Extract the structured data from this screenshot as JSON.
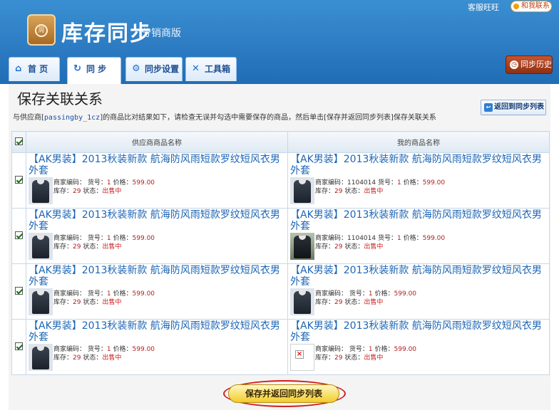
{
  "header": {
    "title": "库存同步",
    "subtitle": "分销商版",
    "logo_text": "周",
    "service_link": "客服旺旺",
    "contact_label": "和我联系"
  },
  "tabs": [
    {
      "label": "首 页",
      "icon": "home-icon"
    },
    {
      "label": "同 步",
      "icon": "sync-icon",
      "active": true
    },
    {
      "label": "同步设置",
      "icon": "settings-gear-icon"
    },
    {
      "label": "工具箱",
      "icon": "tools-icon"
    }
  ],
  "history_label": "同步历史",
  "page": {
    "title": "保存关联关系",
    "desc_before": "与供应商[",
    "supplier_account": "passingby_1cz",
    "desc_after": "]的商品比对结果如下，请检查无误并勾选中需要保存的商品，然后单击[保存并返回同步列表]保存关联关系",
    "back_label": "返回到同步列表"
  },
  "table": {
    "col_supplier": "供应商商品名称",
    "col_mine": "我的商品名称",
    "labels": {
      "code": "商家编码：",
      "sku": "货号：",
      "price": "价格：",
      "stock": "库存：",
      "status": "状态："
    },
    "rows": [
      {
        "checked": true,
        "supplier": {
          "name": "【AK男装】2013秋装新款 航海防风雨短款罗纹短风衣男外套",
          "code": "",
          "sku": "1",
          "price": "599.00",
          "stock": "29",
          "status": "出售中",
          "thumb": "jacket"
        },
        "mine": {
          "name": "【AK男装】2013秋装新款 航海防风雨短款罗纹短风衣男外套",
          "code": "1104014",
          "sku": "1",
          "price": "599.00",
          "stock": "29",
          "status": "出售中",
          "thumb": "jacket"
        }
      },
      {
        "checked": true,
        "supplier": {
          "name": "【AK男装】2013秋装新款 航海防风雨短款罗纹短风衣男外套",
          "code": "",
          "sku": "1",
          "price": "599.00",
          "stock": "29",
          "status": "出售中",
          "thumb": "jacket"
        },
        "mine": {
          "name": "【AK男装】2013秋装新款 航海防风雨短款罗纹短风衣男外套",
          "code": "1104014",
          "sku": "1",
          "price": "599.00",
          "stock": "29",
          "status": "出售中",
          "thumb": "photo"
        }
      },
      {
        "checked": true,
        "supplier": {
          "name": "【AK男装】2013秋装新款 航海防风雨短款罗纹短风衣男外套",
          "code": "",
          "sku": "1",
          "price": "599.00",
          "stock": "29",
          "status": "出售中",
          "thumb": "jacket"
        },
        "mine": {
          "name": "【AK男装】2013秋装新款 航海防风雨短款罗纹短风衣男外套",
          "code": "",
          "sku": "1",
          "price": "599.00",
          "stock": "29",
          "status": "出售中",
          "thumb": "jacket"
        }
      },
      {
        "checked": true,
        "supplier": {
          "name": "【AK男装】2013秋装新款 航海防风雨短款罗纹短风衣男外套",
          "code": "",
          "sku": "1",
          "price": "599.00",
          "stock": "29",
          "status": "出售中",
          "thumb": "jacket"
        },
        "mine": {
          "name": "【AK男装】2013秋装新款 航海防风雨短款罗纹短风衣男外套",
          "code": "",
          "sku": "1",
          "price": "599.00",
          "stock": "29",
          "status": "出售中",
          "thumb": "broken"
        }
      }
    ]
  },
  "save_label": "保存并返回同步列表"
}
